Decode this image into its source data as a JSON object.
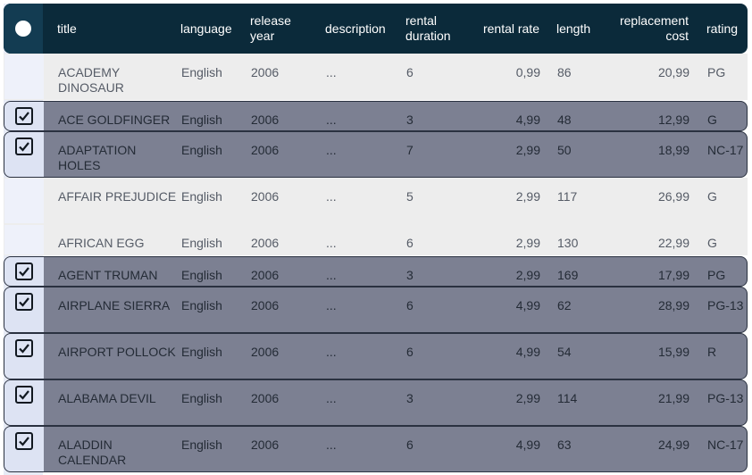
{
  "columns": {
    "title": "title",
    "language": "language",
    "release_year": "release year",
    "description": "description",
    "rental_duration": "rental duration",
    "rental_rate": "rental rate",
    "length": "length",
    "replacement_cost": "replacement cost",
    "rating": "rating"
  },
  "icons": {
    "header_select": "select-all-circle-icon",
    "row_selected": "checkbox-checked-icon"
  },
  "colors": {
    "header_bg": "#0b2a3a",
    "selected_row_bg": "#7c8092",
    "unselected_row_bg": "#ededed",
    "selection_strip": "#e7ebf6"
  },
  "rows": [
    {
      "title": "ACADEMY DINOSAUR",
      "language": "English",
      "release_year": "2006",
      "description": "...",
      "rental_duration": "6",
      "rental_rate": "0,99",
      "length": "86",
      "replacement_cost": "20,99",
      "rating": "PG",
      "selected": false
    },
    {
      "title": "ACE GOLDFINGER",
      "language": "English",
      "release_year": "2006",
      "description": "...",
      "rental_duration": "3",
      "rental_rate": "4,99",
      "length": "48",
      "replacement_cost": "12,99",
      "rating": "G",
      "selected": true
    },
    {
      "title": "ADAPTATION HOLES",
      "language": "English",
      "release_year": "2006",
      "description": "...",
      "rental_duration": "7",
      "rental_rate": "2,99",
      "length": "50",
      "replacement_cost": "18,99",
      "rating": "NC-17",
      "selected": true
    },
    {
      "title": "AFFAIR PREJUDICE",
      "language": "English",
      "release_year": "2006",
      "description": "...",
      "rental_duration": "5",
      "rental_rate": "2,99",
      "length": "117",
      "replacement_cost": "26,99",
      "rating": "G",
      "selected": false
    },
    {
      "title": "AFRICAN EGG",
      "language": "English",
      "release_year": "2006",
      "description": "...",
      "rental_duration": "6",
      "rental_rate": "2,99",
      "length": "130",
      "replacement_cost": "22,99",
      "rating": "G",
      "selected": false
    },
    {
      "title": "AGENT TRUMAN",
      "language": "English",
      "release_year": "2006",
      "description": "...",
      "rental_duration": "3",
      "rental_rate": "2,99",
      "length": "169",
      "replacement_cost": "17,99",
      "rating": "PG",
      "selected": true
    },
    {
      "title": "AIRPLANE SIERRA",
      "language": "English",
      "release_year": "2006",
      "description": "...",
      "rental_duration": "6",
      "rental_rate": "4,99",
      "length": "62",
      "replacement_cost": "28,99",
      "rating": "PG-13",
      "selected": true
    },
    {
      "title": "AIRPORT POLLOCK",
      "language": "English",
      "release_year": "2006",
      "description": "...",
      "rental_duration": "6",
      "rental_rate": "4,99",
      "length": "54",
      "replacement_cost": "15,99",
      "rating": "R",
      "selected": true
    },
    {
      "title": "ALABAMA DEVIL",
      "language": "English",
      "release_year": "2006",
      "description": "...",
      "rental_duration": "3",
      "rental_rate": "2,99",
      "length": "114",
      "replacement_cost": "21,99",
      "rating": "PG-13",
      "selected": true
    },
    {
      "title": "ALADDIN CALENDAR",
      "language": "English",
      "release_year": "2006",
      "description": "...",
      "rental_duration": "6",
      "rental_rate": "4,99",
      "length": "63",
      "replacement_cost": "24,99",
      "rating": "NC-17",
      "selected": true
    }
  ]
}
